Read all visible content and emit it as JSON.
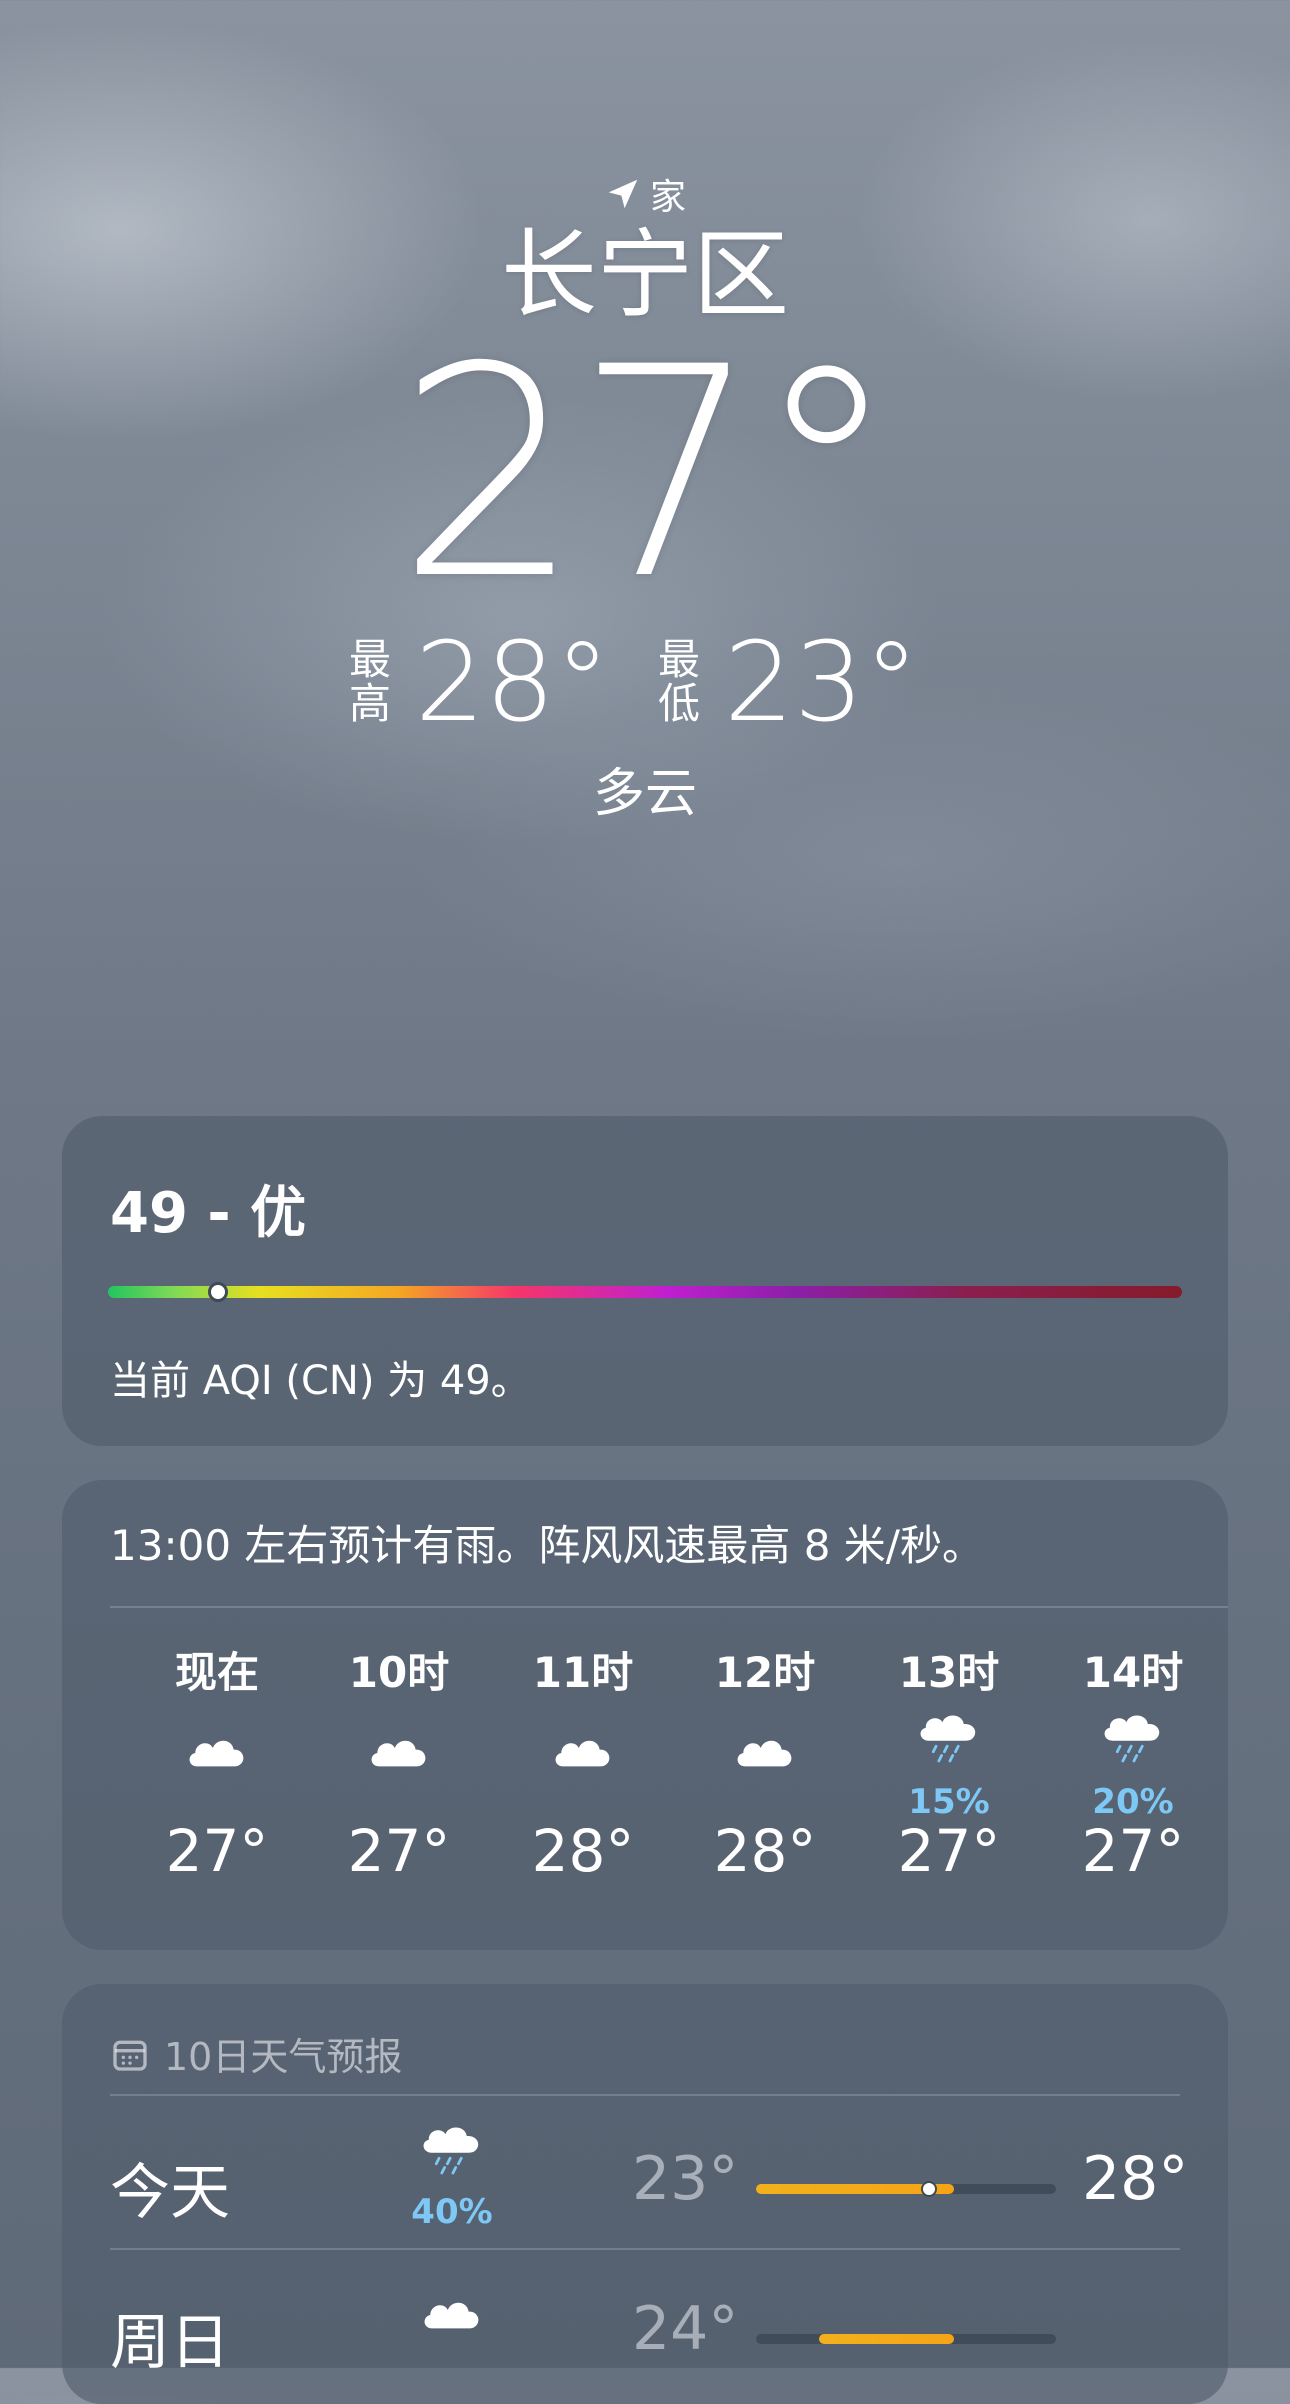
{
  "location": {
    "label": "家",
    "city": "长宁区",
    "temperature": "27°",
    "high_label": "最高",
    "high": "28°",
    "low_label": "最低",
    "low": "23°",
    "condition": "多云"
  },
  "aqi": {
    "title": "49 - 优",
    "value": 49,
    "description": "当前 AQI (CN) 为 49。"
  },
  "hourly": {
    "summary": "13:00 左右预计有雨。阵风风速最高 8 米/秒。",
    "items": [
      {
        "label": "现在",
        "icon": "cloud-icon",
        "pop": "",
        "temp": "27°"
      },
      {
        "label": "10时",
        "icon": "cloud-icon",
        "pop": "",
        "temp": "27°"
      },
      {
        "label": "11时",
        "icon": "cloud-icon",
        "pop": "",
        "temp": "28°"
      },
      {
        "label": "12时",
        "icon": "cloud-icon",
        "pop": "",
        "temp": "28°"
      },
      {
        "label": "13时",
        "icon": "cloud-rain-icon",
        "pop": "15%",
        "temp": "27°"
      },
      {
        "label": "14时",
        "icon": "cloud-rain-icon",
        "pop": "20%",
        "temp": "27°"
      }
    ]
  },
  "daily": {
    "header": "10日天气预报",
    "days": [
      {
        "name": "今天",
        "icon": "cloud-rain-icon",
        "pop": "40%",
        "low": "23°",
        "high": "28°",
        "range_start": 0.0,
        "range_end": 0.66,
        "current": 0.57
      },
      {
        "name": "周日",
        "icon": "cloud-icon",
        "pop": "",
        "low": "24°",
        "high": "",
        "range_start": 0.21,
        "range_end": 0.66
      }
    ]
  },
  "colors": {
    "precip": "#7ec8f5",
    "range_bar": "#f2b11c"
  }
}
